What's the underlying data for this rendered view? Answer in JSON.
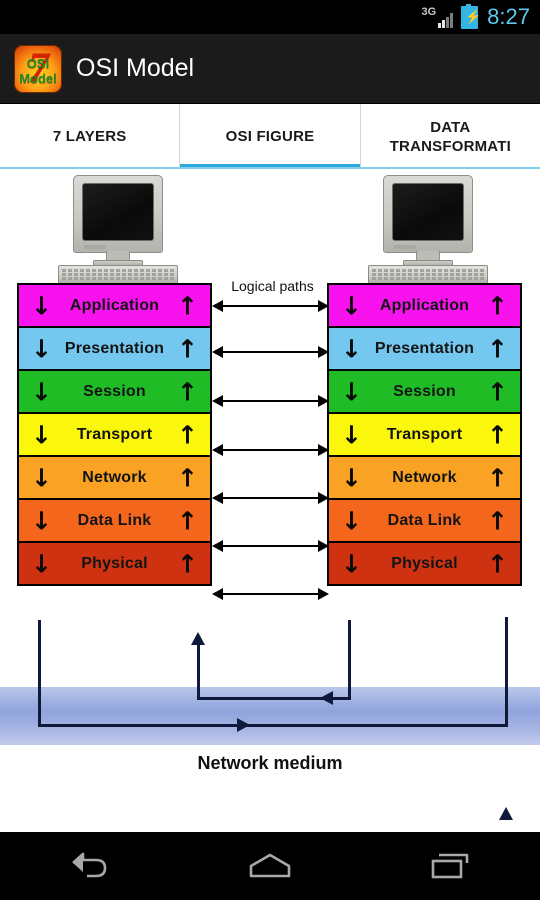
{
  "statusbar": {
    "network_type": "3G",
    "battery_icon": "battery-charging-icon",
    "signal_icon": "signal-bars-icon",
    "time": "8:27"
  },
  "actionbar": {
    "app_icon": "osi-model-app-icon",
    "icon_text_top": "OSI",
    "icon_text_bottom": "Model",
    "icon_numeral": "7",
    "title": "OSI Model"
  },
  "tabs": [
    {
      "label": "7 LAYERS",
      "active": false,
      "name": "tab-7-layers"
    },
    {
      "label": "OSI FIGURE",
      "active": true,
      "name": "tab-osi-figure"
    },
    {
      "label": "DATA\nTRANSFORMATI",
      "active": false,
      "name": "tab-data-transformation"
    }
  ],
  "figure": {
    "logical_paths_label": "Logical paths",
    "network_medium_label": "Network medium",
    "arrow_down": "↓",
    "arrow_up": "↑",
    "layers": [
      {
        "name": "Application",
        "color": "#f712ee"
      },
      {
        "name": "Presentation",
        "color": "#74c8f0"
      },
      {
        "name": "Session",
        "color": "#1fbc26"
      },
      {
        "name": "Transport",
        "color": "#fbf70c"
      },
      {
        "name": "Network",
        "color": "#f9a224"
      },
      {
        "name": "Data Link",
        "color": "#f4661b"
      },
      {
        "name": "Physical",
        "color": "#cf3210"
      }
    ],
    "hosts": [
      {
        "name": "host-left-computer"
      },
      {
        "name": "host-right-computer"
      }
    ],
    "accent_color": "#2ca9dd",
    "medium_color": "#8fa3dd"
  },
  "navbar": {
    "back_label": "back-icon",
    "home_label": "home-icon",
    "recents_label": "recents-icon"
  }
}
